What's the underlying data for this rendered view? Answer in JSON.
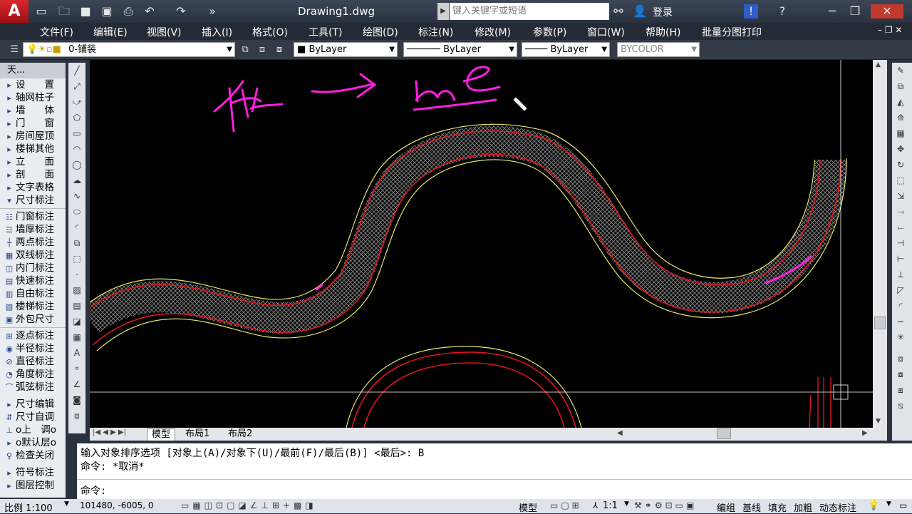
{
  "app": {
    "logo_letter": "A",
    "doc_title": "Drawing1.dwg"
  },
  "search": {
    "placeholder": "键入关键字或短语"
  },
  "user": {
    "login_label": "登录"
  },
  "menu": [
    "文件(F)",
    "编辑(E)",
    "视图(V)",
    "插入(I)",
    "格式(O)",
    "工具(T)",
    "绘图(D)",
    "标注(N)",
    "修改(M)",
    "参数(P)",
    "窗口(W)",
    "帮助(H)",
    "批量分图打印"
  ],
  "toolbar": {
    "layer_value": "0-铺装",
    "color_value": "ByLayer",
    "linetype_value": "ByLayer",
    "lineweight_value": "ByLayer",
    "plotstyle_value": "BYCOLOR"
  },
  "left_panel": {
    "header": "天...",
    "group1": [
      "设　　置",
      "轴网柱子",
      "墙　　体",
      "门　　窗",
      "房间屋顶",
      "楼梯其他",
      "立　　面",
      "剖　　面",
      "文字表格",
      "尺寸标注"
    ],
    "group2": [
      "门窗标注",
      "墙厚标注",
      "两点标注",
      "双线标注",
      "内门标注",
      "快速标注",
      "自由标注",
      "楼梯标注",
      "外包尺寸"
    ],
    "group3": [
      "逐点标注",
      "半径标注",
      "直径标注",
      "角度标注",
      "弧弦标注"
    ],
    "group4": [
      "尺寸编辑",
      "尺寸自调",
      "o上　调o",
      "o默认层o",
      "检查关闭"
    ],
    "group5": [
      "符号标注",
      "图层控制"
    ]
  },
  "canvas": {
    "colors": {
      "background": "#000000",
      "outline": "#e8e86a",
      "wall": "#e0141e",
      "annotation": "#ff1ee0",
      "crosshair": "#ffffff"
    }
  },
  "tabs": {
    "model": "模型",
    "layout1": "布局1",
    "layout2": "布局2"
  },
  "command": {
    "line1": "输入对象排序选项 [对象上(A)/对象下(U)/最前(F)/最后(B)] <最后>: B",
    "line2": "命令: *取消*",
    "prompt": "命令:"
  },
  "status": {
    "scale": "比例 1:100",
    "coords": "101480, -6005, 0",
    "model_label": "模型",
    "annot_scale": "1:1",
    "buttons": [
      "编组",
      "基线",
      "填充",
      "加粗",
      "动态标注"
    ]
  }
}
